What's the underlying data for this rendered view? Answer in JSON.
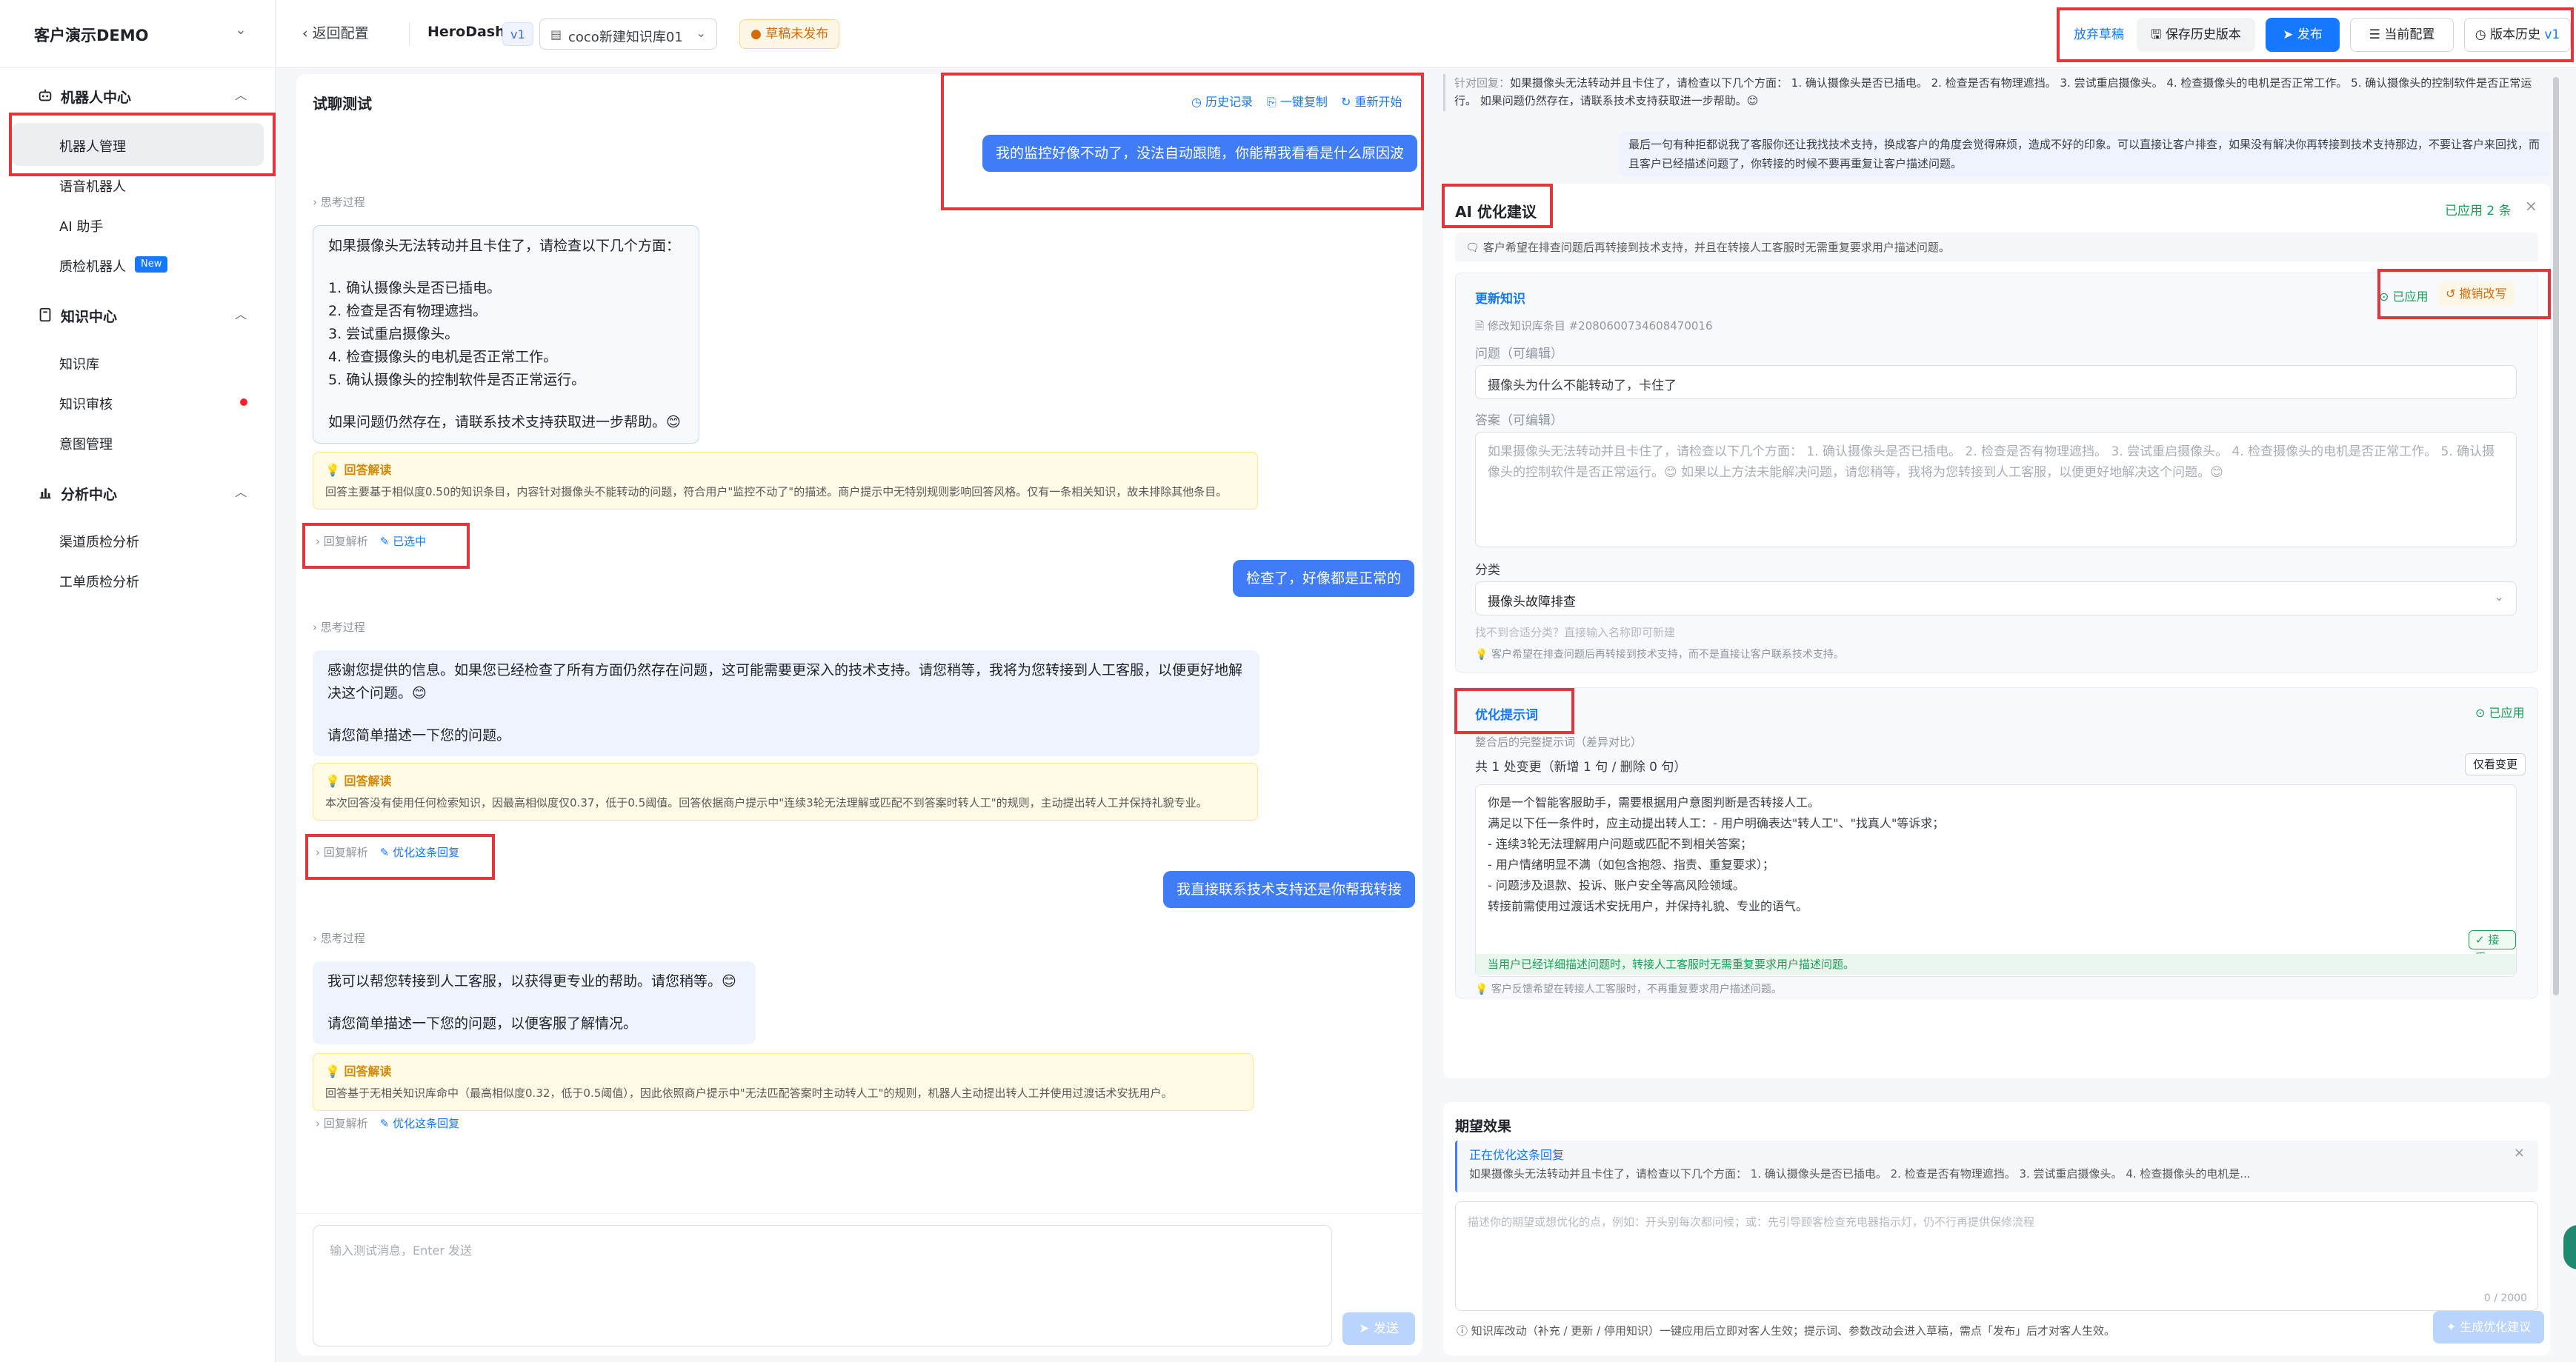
{
  "sidebar": {
    "title": "客户演示DEMO",
    "sections": [
      {
        "label": "机器人中心",
        "items": [
          "机器人管理",
          "语音机器人",
          "AI 助手",
          "质检机器人"
        ]
      },
      {
        "label": "知识中心",
        "items": [
          "知识库",
          "知识审核",
          "意图管理"
        ]
      },
      {
        "label": "分析中心",
        "items": [
          "渠道质检分析",
          "工单质检分析"
        ]
      }
    ],
    "new_badge": "New"
  },
  "topbar": {
    "back": "返回配置",
    "bot_name": "HeroDash",
    "version_tag": "v1",
    "kb_select": "coco新建知识库01",
    "draft_status": "草稿未发布",
    "discard": "放弃草稿",
    "save_version": "保存历史版本",
    "publish": "发布",
    "current_config": "当前配置",
    "version_history": "版本历史",
    "version_history_tag": "v1"
  },
  "chat": {
    "title": "试聊测试",
    "history": "历史记录",
    "copy_all": "一键复制",
    "restart": "重新开始",
    "think_label": "思考过程",
    "messages": [
      {
        "role": "user",
        "text": "我的监控好像不动了，没法自动跟随，你能帮我看看是什么原因波"
      },
      {
        "role": "bot",
        "lines": [
          "如果摄像头无法转动并且卡住了，请检查以下几个方面：",
          "",
          "1. 确认摄像头是否已插电。",
          "2. 检查是否有物理遮挡。",
          "3. 尝试重启摄像头。",
          "4. 检查摄像头的电机是否正常工作。",
          "5. 确认摄像头的控制软件是否正常运行。",
          "",
          "如果问题仍然存在，请联系技术支持获取进一步帮助。😊"
        ],
        "explain_title": "回答解读",
        "explain": "回答主要基于相似度0.50的知识条目，内容针对摄像头不能转动的问题，符合用户\"监控不动了\"的描述。商户提示中无特别规则影响回答风格。仅有一条相关知识，故未排除其他条目。",
        "action_parse": "回复解析",
        "action_status": "已选中"
      },
      {
        "role": "user",
        "text": "检查了，好像都是正常的"
      },
      {
        "role": "bot",
        "lines": [
          "感谢您提供的信息。如果您已经检查了所有方面仍然存在问题，这可能需要更深入的技术支持。请您稍等，我将为您转接到人工客服，以便更好地解",
          "决这个问题。😊",
          "",
          "请您简单描述一下您的问题。"
        ],
        "explain_title": "回答解读",
        "explain": "本次回答没有使用任何检索知识，因最高相似度仅0.37，低于0.5阈值。回答依据商户提示中\"连续3轮无法理解或匹配不到答案时转人工\"的规则，主动提出转人工并保持礼貌专业。",
        "action_parse": "回复解析",
        "action_status": "优化这条回复"
      },
      {
        "role": "user",
        "text": "我直接联系技术支持还是你帮我转接"
      },
      {
        "role": "bot",
        "lines": [
          "我可以帮您转接到人工客服，以获得更专业的帮助。请您稍等。😊",
          "",
          "请您简单描述一下您的问题，以便客服了解情况。"
        ],
        "explain_title": "回答解读",
        "explain": "回答基于无相关知识库命中（最高相似度0.32，低于0.5阈值），因此依照商户提示中\"无法匹配答案时主动转人工\"的规则，机器人主动提出转人工并使用过渡话术安抚用户。",
        "action_parse": "回复解析",
        "action_status": "优化这条回复"
      }
    ],
    "input_placeholder": "输入测试消息，Enter 发送",
    "send": "发送"
  },
  "right": {
    "context_label": "针对回复：",
    "context_text": "如果摄像头无法转动并且卡住了，请检查以下几个方面： 1. 确认摄像头是否已插电。 2. 检查是否有物理遮挡。 3. 尝试重启摄像头。 4. 检查摄像头的电机是否正常工作。 5. 确认摄像头的控制软件是否正常运行。 如果问题仍然存在，请联系技术支持获取进一步帮助。😊",
    "feedback": "最后一句有种拒都说我了客服你还让我找技术支持，换成客户的角度会觉得麻烦，造成不好的印象。可以直接让客户排查，如果没有解决你再转接到技术支持那边，不要让客户来回找，而且客户已经描述问题了，你转接的时候不要再重复让客户描述问题。",
    "ai_suggest_title": "AI 优化建议",
    "applied_count": "已应用 2 条",
    "ai_suggest_summary": "客户希望在排查问题后再转接到技术支持，并且在转接人工客服时无需重复要求用户描述问题。",
    "update_knowledge": {
      "title": "更新知识",
      "applied": "已应用",
      "revoke": "撤销改写",
      "ref": "修改知识库条目 #2080600734608470016",
      "q_label": "问题（可编辑）",
      "q_value": "摄像头为什么不能转动了，卡住了",
      "a_label": "答案（可编辑）",
      "a_value": "如果摄像头无法转动并且卡住了，请检查以下几个方面： 1. 确认摄像头是否已插电。 2. 检查是否有物理遮挡。 3. 尝试重启摄像头。 4. 检查摄像头的电机是否正常工作。 5. 确认摄像头的控制软件是否正常运行。😊 如果以上方法未能解决问题，请您稍等，我将为您转接到人工客服，以便更好地解决这个问题。😊",
      "cat_label": "分类",
      "cat_value": "摄像头故障排查",
      "cat_hint": "找不到合适分类？直接输入名称即可新建",
      "reason": "客户希望在排查问题后再转接到技术支持，而不是直接让客户联系技术支持。"
    },
    "optimize_prompt": {
      "title": "优化提示词",
      "applied": "已应用",
      "subtitle": "整合后的完整提示词（差异对比）",
      "summary": "共 1 处变更（新增 1 句 / 删除 0 句）",
      "only_diff": "仅看变更",
      "lines": [
        "你是一个智能客服助手，需要根据用户意图判断是否转接人工。",
        "满足以下任一条件时，应主动提出转人工：- 用户明确表达\"转人工\"、\"找真人\"等诉求；",
        "- 连续3轮无法理解用户问题或匹配不到相关答案；",
        "- 用户情绪明显不满（如包含抱怨、指责、重复要求）；",
        "- 问题涉及退款、投诉、账户安全等高风险领域。",
        "转接前需使用过渡话术安抚用户，并保持礼貌、专业的语气。"
      ],
      "accept": "接受",
      "added_line": "当用户已经详细描述问题时，转接人工客服时无需重复要求用户描述问题。",
      "reason": "客户反馈希望在转接人工客服时，不再重复要求用户描述问题。"
    },
    "expect": {
      "title": "期望效果",
      "optimizing": "正在优化这条回复",
      "optimizing_text": "如果摄像头无法转动并且卡住了，请检查以下几个方面： 1. 确认摄像头是否已插电。 2. 检查是否有物理遮挡。 3. 尝试重启摄像头。 4. 检查摄像头的电机是...",
      "placeholder": "描述你的期望或想优化的点，例如：开头别每次都问候；或：先引导顾客检查充电器指示灯，仍不行再提供保修流程",
      "counter": "0 / 2000",
      "footer_note": "知识库改动（补充 / 更新 / 停用知识）一键应用后立即对客人生效；提示词、参数改动会进入草稿，需点「发布」后才对客人生效。",
      "generate": "生成优化建议"
    }
  },
  "colors": {
    "accent": "#1677ff",
    "highlight": "#e5353c",
    "success": "#18a058",
    "warning": "#d48806"
  }
}
